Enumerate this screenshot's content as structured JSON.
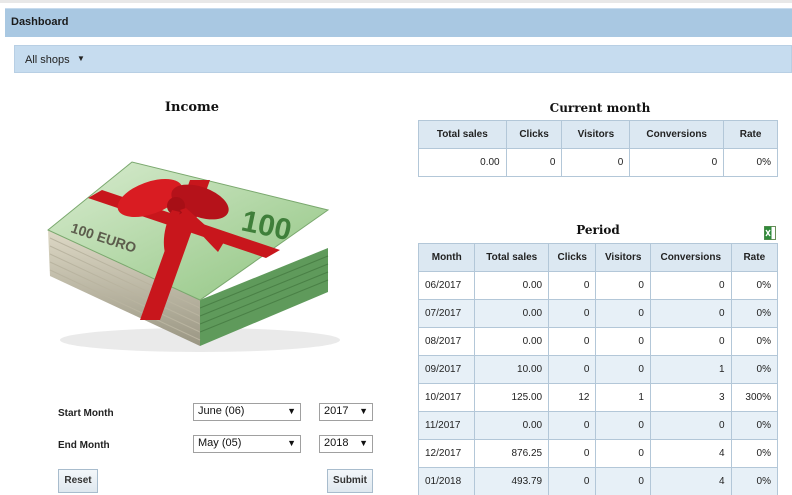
{
  "header": {
    "title": "Dashboard"
  },
  "shops": {
    "label": "All shops"
  },
  "income": {
    "title": "Income"
  },
  "form": {
    "start_label": "Start Month",
    "end_label": "End Month",
    "start_month": "June (06)",
    "start_year": "2017",
    "end_month": "May (05)",
    "end_year": "2018",
    "reset_label": "Reset",
    "submit_label": "Submit"
  },
  "current_month": {
    "title": "Current month",
    "headers": [
      "Total sales",
      "Clicks",
      "Visitors",
      "Conversions",
      "Rate"
    ],
    "row": [
      "0.00",
      "0",
      "0",
      "0",
      "0%"
    ]
  },
  "period": {
    "title": "Period",
    "export_icon": "excel-export-icon",
    "headers": [
      "Month",
      "Total sales",
      "Clicks",
      "Visitors",
      "Conversions",
      "Rate"
    ],
    "rows": [
      [
        "06/2017",
        "0.00",
        "0",
        "0",
        "0",
        "0%"
      ],
      [
        "07/2017",
        "0.00",
        "0",
        "0",
        "0",
        "0%"
      ],
      [
        "08/2017",
        "0.00",
        "0",
        "0",
        "0",
        "0%"
      ],
      [
        "09/2017",
        "10.00",
        "0",
        "0",
        "1",
        "0%"
      ],
      [
        "10/2017",
        "125.00",
        "12",
        "1",
        "3",
        "300%"
      ],
      [
        "11/2017",
        "0.00",
        "0",
        "0",
        "0",
        "0%"
      ],
      [
        "12/2017",
        "876.25",
        "0",
        "0",
        "4",
        "0%"
      ],
      [
        "01/2018",
        "493.79",
        "0",
        "0",
        "4",
        "0%"
      ]
    ]
  },
  "illustration": {
    "banknote_label": "100 EURO",
    "banknote_value": "100"
  }
}
